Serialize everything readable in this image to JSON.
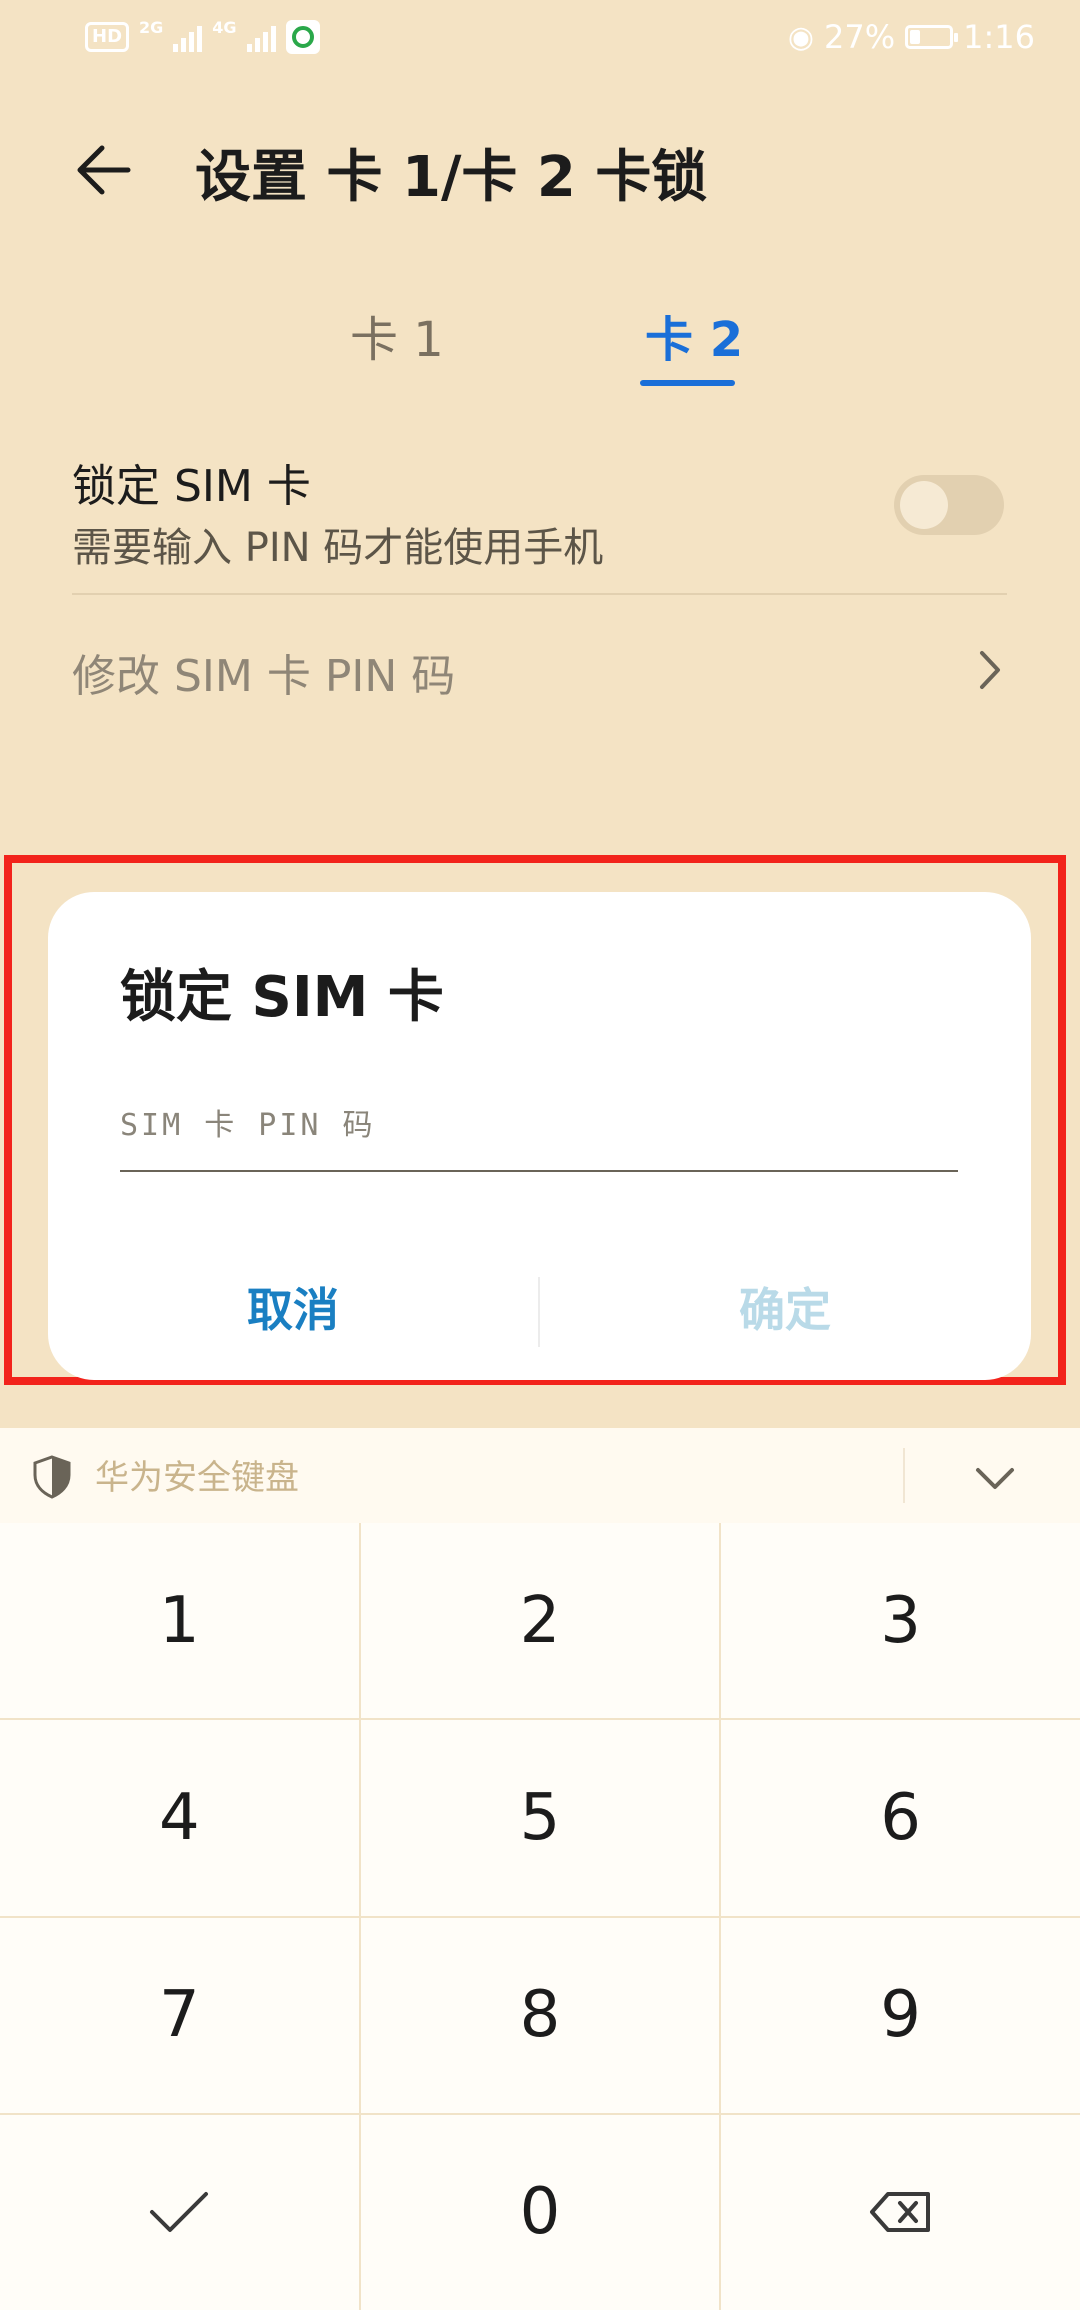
{
  "status_bar": {
    "hd": "HD",
    "network_1": "2G",
    "network_2": "4G",
    "battery_percent": "27%",
    "battery_level": 0.27,
    "time": "1:16"
  },
  "header": {
    "title": "设置 卡 1/卡 2 卡锁",
    "back_icon": "arrow-left-icon"
  },
  "tabs": [
    {
      "label": "卡 1",
      "selected": false
    },
    {
      "label": "卡 2",
      "selected": true
    }
  ],
  "settings": {
    "lock_sim": {
      "title": "锁定 SIM 卡",
      "subtitle": "需要输入 PIN 码才能使用手机",
      "enabled": false
    },
    "change_pin": {
      "label": "修改 SIM 卡 PIN 码"
    }
  },
  "dialog": {
    "title": "锁定 SIM 卡",
    "input_placeholder": "SIM 卡 PIN 码",
    "input_value": "",
    "cancel_label": "取消",
    "confirm_label": "确定"
  },
  "keyboard": {
    "label": "华为安全键盘",
    "keys": [
      "1",
      "2",
      "3",
      "4",
      "5",
      "6",
      "7",
      "8",
      "9",
      "0"
    ]
  },
  "colors": {
    "background": "#f4e3c4",
    "accent": "#1a6fd8",
    "cancel": "#1a7fc2",
    "confirm_disabled": "#b9dae8",
    "highlight": "#f2231b"
  }
}
